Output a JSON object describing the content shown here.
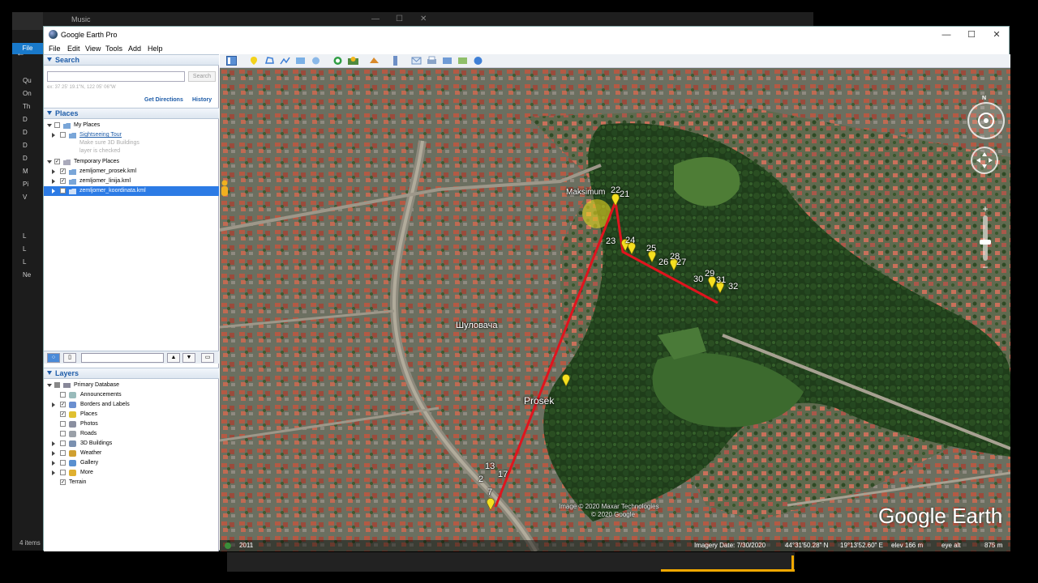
{
  "window": {
    "title": "Google Earth Pro",
    "minimize": "—",
    "maximize": "☐",
    "close": "✕"
  },
  "background": {
    "music_title": "Music",
    "explorer_file_tab": "File",
    "explorer_items": [
      "Qu",
      "On",
      "Th",
      "D",
      "D",
      "D",
      "D",
      "M",
      "Pi",
      "V",
      "",
      "",
      "L",
      "L",
      "L",
      "Ne"
    ],
    "status_count": "4 items"
  },
  "menu": [
    "File",
    "Edit",
    "View",
    "Tools",
    "Add",
    "Help"
  ],
  "search": {
    "header": "Search",
    "input_value": "",
    "button": "Search",
    "hint": "ex: 37 25' 19.1\"N, 122 05' 06\"W",
    "get_directions": "Get Directions",
    "history": "History"
  },
  "places": {
    "header": "Places",
    "my_places": "My Places",
    "sightseeing_tour": "Sightseeing Tour",
    "hint_line1": "Make sure 3D Buildings",
    "hint_line2": "layer is checked",
    "temporary_places": "Temporary Places",
    "items": [
      "zemljomer_prosek.kml",
      "zemljomer_linija.kml",
      "zemljomer_koordinata.kml"
    ]
  },
  "layers": {
    "header": "Layers",
    "primary_database": "Primary Database",
    "items": [
      "Announcements",
      "Borders and Labels",
      "Places",
      "Photos",
      "Roads",
      "3D Buildings",
      "Weather",
      "Gallery",
      "More"
    ],
    "terrain": "Terrain"
  },
  "map": {
    "place_labels": {
      "maksimum": "Maksimum",
      "prosek": "Prosek",
      "sulovaca": "Шуловача"
    },
    "pin_numbers": [
      "22",
      "21",
      "23",
      "24",
      "25",
      "26",
      "27",
      "28",
      "29",
      "30",
      "31",
      "32",
      "13",
      "17",
      "2",
      "7"
    ],
    "watermark": "Google Earth",
    "copyright_line1": "Image © 2020 Maxar Technologies",
    "copyright_line2": "© 2020 Google",
    "compass_north": "N",
    "status": {
      "year": "2011",
      "imagery_date": "Imagery Date: 7/30/2020",
      "lat": "44°31'50.28\" N",
      "lon": "19°13'52.60\" E",
      "elev": "elev  166 m",
      "eye_alt": "eye alt",
      "eye_alt_value": "875 m"
    },
    "route_color": "#e0141e",
    "pin_color": "#f5e020"
  }
}
